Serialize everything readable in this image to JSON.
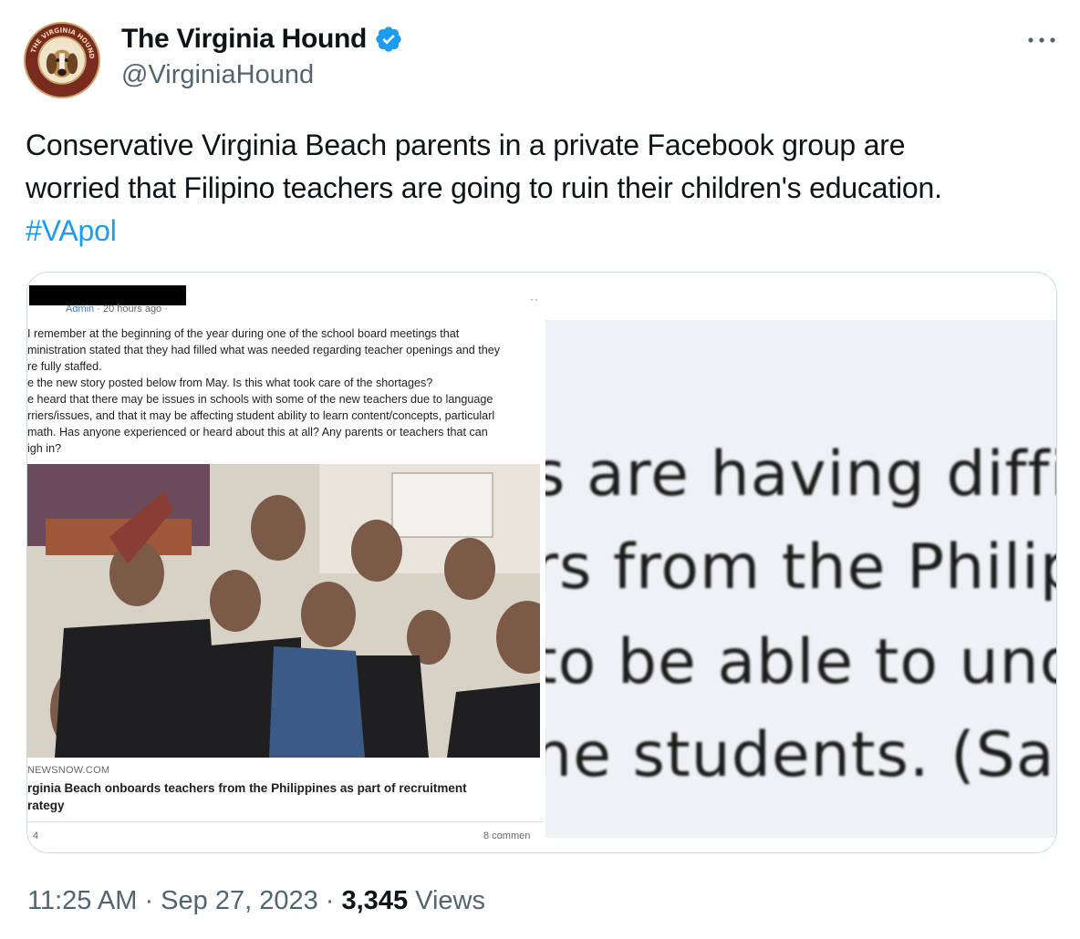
{
  "author": {
    "display_name": "The Virginia Hound",
    "handle": "@VirginiaHound",
    "verified": true,
    "avatar_icon": "hound-logo-avatar",
    "avatar_ring_text": "THE VIRGINIA HOUND"
  },
  "more_icon": "more-horizontal-icon",
  "tweet": {
    "text_line1": "Conservative Virginia Beach parents in a private Facebook group are",
    "text_line2": "worried that Filipino teachers are going to ruin their children's education.",
    "hashtag": "#VApol"
  },
  "media": {
    "left_image": {
      "meta_admin": "Admin",
      "meta_time": " · 20 hours ago · ",
      "post_lines": [
        "I remember at the beginning of the year during one of the school board meetings that",
        "ministration stated that they had filled what was needed regarding teacher openings and they",
        "re fully staffed.",
        "e the new story posted below from May. Is this what took care of the shortages?",
        "e heard that there may be issues in schools with some of the new teachers due to language",
        "rriers/issues, and that it may be affecting student ability to learn content/concepts, particularl",
        "math. Has anyone experienced or heard about this at all? Any parents or teachers that can",
        "igh in?"
      ],
      "link_source": "NEWSNOW.COM",
      "link_headline_line1": "rginia Beach onboards teachers from the Philippines as part of recruitment",
      "link_headline_line2": "rategy",
      "reactions": "4",
      "comments": "8 commen"
    },
    "right_image": {
      "zoom_lines": [
        "s are having diffic",
        "rs from the Philip",
        "to be able to und",
        "he students. (Sal"
      ]
    }
  },
  "footer": {
    "time": "11:25 AM",
    "sep1": " · ",
    "date": "Sep 27, 2023",
    "sep2": " · ",
    "views_count": "3,345",
    "views_label": " Views"
  },
  "colors": {
    "link_blue": "#1d9bf0",
    "secondary_text": "#536471",
    "verified_blue": "#1d9bf0"
  }
}
